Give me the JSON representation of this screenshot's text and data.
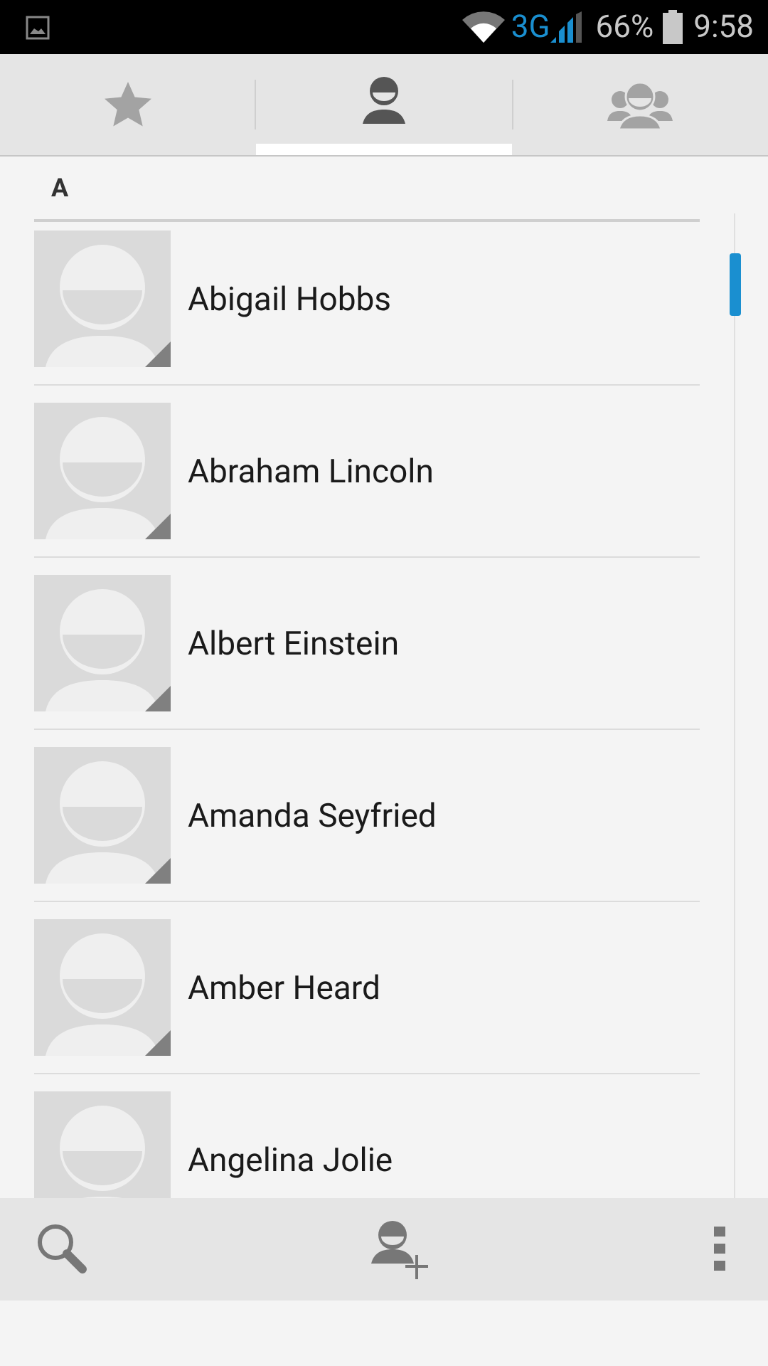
{
  "status_bar": {
    "network": "3G",
    "battery": "66%",
    "time": "9:58"
  },
  "tabs": [
    {
      "kind": "favorites",
      "selected": false
    },
    {
      "kind": "contacts",
      "selected": true
    },
    {
      "kind": "groups",
      "selected": false
    }
  ],
  "section": "A",
  "contacts": [
    {
      "name": "Abigail Hobbs"
    },
    {
      "name": "Abraham Lincoln"
    },
    {
      "name": "Albert Einstein"
    },
    {
      "name": "Amanda Seyfried"
    },
    {
      "name": "Amber Heard"
    },
    {
      "name": "Angelina Jolie"
    }
  ]
}
